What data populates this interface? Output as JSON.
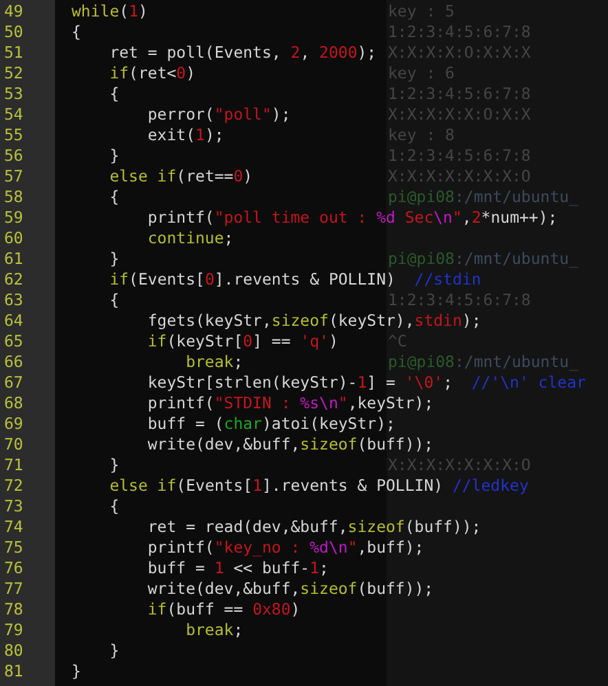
{
  "editor": {
    "lines": [
      {
        "number": "49",
        "code": [
          {
            "kind": "kw",
            "text": "while"
          },
          {
            "kind": "p",
            "text": "("
          },
          {
            "kind": "num",
            "text": "1"
          },
          {
            "kind": "p",
            "text": ")"
          }
        ],
        "terminal": [
          {
            "kind": "out",
            "text": "key : 5"
          }
        ]
      },
      {
        "number": "50",
        "code": [
          {
            "kind": "p",
            "text": "{"
          }
        ],
        "terminal": [
          {
            "kind": "out",
            "text": "1:2:3:4:5:6:7:8"
          }
        ]
      },
      {
        "number": "51",
        "code": [
          {
            "kind": "p",
            "text": "    ret = poll(Events, "
          },
          {
            "kind": "num",
            "text": "2"
          },
          {
            "kind": "p",
            "text": ", "
          },
          {
            "kind": "num",
            "text": "2000"
          },
          {
            "kind": "p",
            "text": ");"
          }
        ],
        "terminal": [
          {
            "kind": "out",
            "text": "X:X:X:X:O:X:X:X"
          }
        ]
      },
      {
        "number": "52",
        "code": [
          {
            "kind": "kw",
            "text": "    if"
          },
          {
            "kind": "p",
            "text": "(ret<"
          },
          {
            "kind": "num",
            "text": "0"
          },
          {
            "kind": "p",
            "text": ")"
          }
        ],
        "terminal": [
          {
            "kind": "out",
            "text": "key : 6"
          }
        ]
      },
      {
        "number": "53",
        "code": [
          {
            "kind": "p",
            "text": "    {"
          }
        ],
        "terminal": [
          {
            "kind": "out",
            "text": "1:2:3:4:5:6:7:8"
          }
        ]
      },
      {
        "number": "54",
        "code": [
          {
            "kind": "p",
            "text": "        perror("
          },
          {
            "kind": "str",
            "text": "\"poll\""
          },
          {
            "kind": "p",
            "text": ");"
          }
        ],
        "terminal": [
          {
            "kind": "out",
            "text": "X:X:X:X:X:O:X:X"
          }
        ]
      },
      {
        "number": "55",
        "code": [
          {
            "kind": "p",
            "text": "        exit("
          },
          {
            "kind": "num",
            "text": "1"
          },
          {
            "kind": "p",
            "text": ");"
          }
        ],
        "terminal": [
          {
            "kind": "out",
            "text": "key : 8"
          }
        ]
      },
      {
        "number": "56",
        "code": [
          {
            "kind": "p",
            "text": "    }"
          }
        ],
        "terminal": [
          {
            "kind": "out",
            "text": "1:2:3:4:5:6:7:8"
          }
        ]
      },
      {
        "number": "57",
        "code": [
          {
            "kind": "kw",
            "text": "    else if"
          },
          {
            "kind": "p",
            "text": "(ret=="
          },
          {
            "kind": "num",
            "text": "0"
          },
          {
            "kind": "p",
            "text": ")"
          }
        ],
        "terminal": [
          {
            "kind": "out",
            "text": "X:X:X:X:X:X:X:O"
          }
        ]
      },
      {
        "number": "58",
        "code": [
          {
            "kind": "p",
            "text": "    {"
          }
        ],
        "terminal": [
          {
            "kind": "host",
            "text": "pi@pi08"
          },
          {
            "kind": "path",
            "text": ":/mnt/ubuntu_"
          }
        ]
      },
      {
        "number": "59",
        "code": [
          {
            "kind": "p",
            "text": "        printf("
          },
          {
            "kind": "str",
            "text": "\"poll time out : "
          },
          {
            "kind": "fmt",
            "text": "%d"
          },
          {
            "kind": "str",
            "text": " Sec"
          },
          {
            "kind": "fmt",
            "text": "\\n"
          },
          {
            "kind": "str",
            "text": "\""
          },
          {
            "kind": "p",
            "text": ","
          },
          {
            "kind": "num",
            "text": "2"
          },
          {
            "kind": "p",
            "text": "*num++);"
          }
        ]
      },
      {
        "number": "60",
        "code": [
          {
            "kind": "kw",
            "text": "        continue"
          },
          {
            "kind": "p",
            "text": ";"
          }
        ]
      },
      {
        "number": "61",
        "code": [
          {
            "kind": "p",
            "text": "    }"
          }
        ],
        "terminal": [
          {
            "kind": "host",
            "text": "pi@pi08"
          },
          {
            "kind": "path",
            "text": ":/mnt/ubuntu_"
          }
        ]
      },
      {
        "number": "62",
        "code": [
          {
            "kind": "kw",
            "text": "    if"
          },
          {
            "kind": "p",
            "text": "(Events["
          },
          {
            "kind": "num",
            "text": "0"
          },
          {
            "kind": "p",
            "text": "].revents & POLLIN)  "
          },
          {
            "kind": "cmt",
            "text": "//stdin"
          }
        ]
      },
      {
        "number": "63",
        "code": [
          {
            "kind": "p",
            "text": "    {"
          }
        ],
        "terminal": [
          {
            "kind": "out",
            "text": "1:2:3:4:5:6:7:8"
          }
        ]
      },
      {
        "number": "64",
        "code": [
          {
            "kind": "p",
            "text": "        fgets(keyStr,"
          },
          {
            "kind": "kw",
            "text": "sizeof"
          },
          {
            "kind": "p",
            "text": "(keyStr),"
          },
          {
            "kind": "num",
            "text": "stdin"
          },
          {
            "kind": "p",
            "text": ");"
          }
        ]
      },
      {
        "number": "65",
        "code": [
          {
            "kind": "kw",
            "text": "        if"
          },
          {
            "kind": "p",
            "text": "(keyStr["
          },
          {
            "kind": "num",
            "text": "0"
          },
          {
            "kind": "p",
            "text": "] == "
          },
          {
            "kind": "str",
            "text": "'q'"
          },
          {
            "kind": "p",
            "text": ")"
          }
        ],
        "terminal": [
          {
            "kind": "out",
            "text": "^C"
          }
        ]
      },
      {
        "number": "66",
        "code": [
          {
            "kind": "kw",
            "text": "            break"
          },
          {
            "kind": "p",
            "text": ";"
          }
        ],
        "terminal": [
          {
            "kind": "host",
            "text": "pi@pi08"
          },
          {
            "kind": "path",
            "text": ":/mnt/ubuntu_"
          }
        ]
      },
      {
        "number": "67",
        "code": [
          {
            "kind": "p",
            "text": "        keyStr[strlen(keyStr)-"
          },
          {
            "kind": "num",
            "text": "1"
          },
          {
            "kind": "p",
            "text": "] = "
          },
          {
            "kind": "str",
            "text": "'\\0'"
          },
          {
            "kind": "p",
            "text": ";  "
          },
          {
            "kind": "cmt",
            "text": "//'\\n' clear"
          }
        ]
      },
      {
        "number": "68",
        "code": [
          {
            "kind": "p",
            "text": "        printf("
          },
          {
            "kind": "str",
            "text": "\"STDIN : "
          },
          {
            "kind": "fmt",
            "text": "%s\\n"
          },
          {
            "kind": "str",
            "text": "\""
          },
          {
            "kind": "p",
            "text": ",keyStr);"
          }
        ]
      },
      {
        "number": "69",
        "code": [
          {
            "kind": "p",
            "text": "        buff = ("
          },
          {
            "kind": "type",
            "text": "char"
          },
          {
            "kind": "p",
            "text": ")atoi(keyStr);"
          }
        ]
      },
      {
        "number": "70",
        "code": [
          {
            "kind": "p",
            "text": "        write(dev,&buff,"
          },
          {
            "kind": "kw",
            "text": "sizeof"
          },
          {
            "kind": "p",
            "text": "(buff));"
          }
        ]
      },
      {
        "number": "71",
        "code": [
          {
            "kind": "p",
            "text": "    }"
          }
        ],
        "terminal": [
          {
            "kind": "out",
            "text": "X:X:X:X:X:X:X:O"
          }
        ]
      },
      {
        "number": "72",
        "code": [
          {
            "kind": "kw",
            "text": "    else if"
          },
          {
            "kind": "p",
            "text": "(Events["
          },
          {
            "kind": "num",
            "text": "1"
          },
          {
            "kind": "p",
            "text": "].revents & POLLIN) "
          },
          {
            "kind": "cmt",
            "text": "//ledkey"
          }
        ]
      },
      {
        "number": "73",
        "code": [
          {
            "kind": "p",
            "text": "    {"
          }
        ]
      },
      {
        "number": "74",
        "code": [
          {
            "kind": "p",
            "text": "        ret = read(dev,&buff,"
          },
          {
            "kind": "kw",
            "text": "sizeof"
          },
          {
            "kind": "p",
            "text": "(buff));"
          }
        ]
      },
      {
        "number": "75",
        "code": [
          {
            "kind": "p",
            "text": "        printf("
          },
          {
            "kind": "str",
            "text": "\"key_no : "
          },
          {
            "kind": "fmt",
            "text": "%d\\n"
          },
          {
            "kind": "str",
            "text": "\""
          },
          {
            "kind": "p",
            "text": ",buff);"
          }
        ]
      },
      {
        "number": "76",
        "code": [
          {
            "kind": "p",
            "text": "        buff = "
          },
          {
            "kind": "num",
            "text": "1"
          },
          {
            "kind": "p",
            "text": " << buff-"
          },
          {
            "kind": "num",
            "text": "1"
          },
          {
            "kind": "p",
            "text": ";"
          }
        ]
      },
      {
        "number": "77",
        "code": [
          {
            "kind": "p",
            "text": "        write(dev,&buff,"
          },
          {
            "kind": "kw",
            "text": "sizeof"
          },
          {
            "kind": "p",
            "text": "(buff));"
          }
        ]
      },
      {
        "number": "78",
        "code": [
          {
            "kind": "kw",
            "text": "        if"
          },
          {
            "kind": "p",
            "text": "(buff == "
          },
          {
            "kind": "num",
            "text": "0x80"
          },
          {
            "kind": "p",
            "text": ")"
          }
        ]
      },
      {
        "number": "79",
        "code": [
          {
            "kind": "kw",
            "text": "            break"
          },
          {
            "kind": "p",
            "text": ";"
          }
        ]
      },
      {
        "number": "80",
        "code": [
          {
            "kind": "p",
            "text": "    }"
          }
        ]
      },
      {
        "number": "81",
        "code": [
          {
            "kind": "p",
            "text": "}"
          }
        ]
      }
    ]
  }
}
